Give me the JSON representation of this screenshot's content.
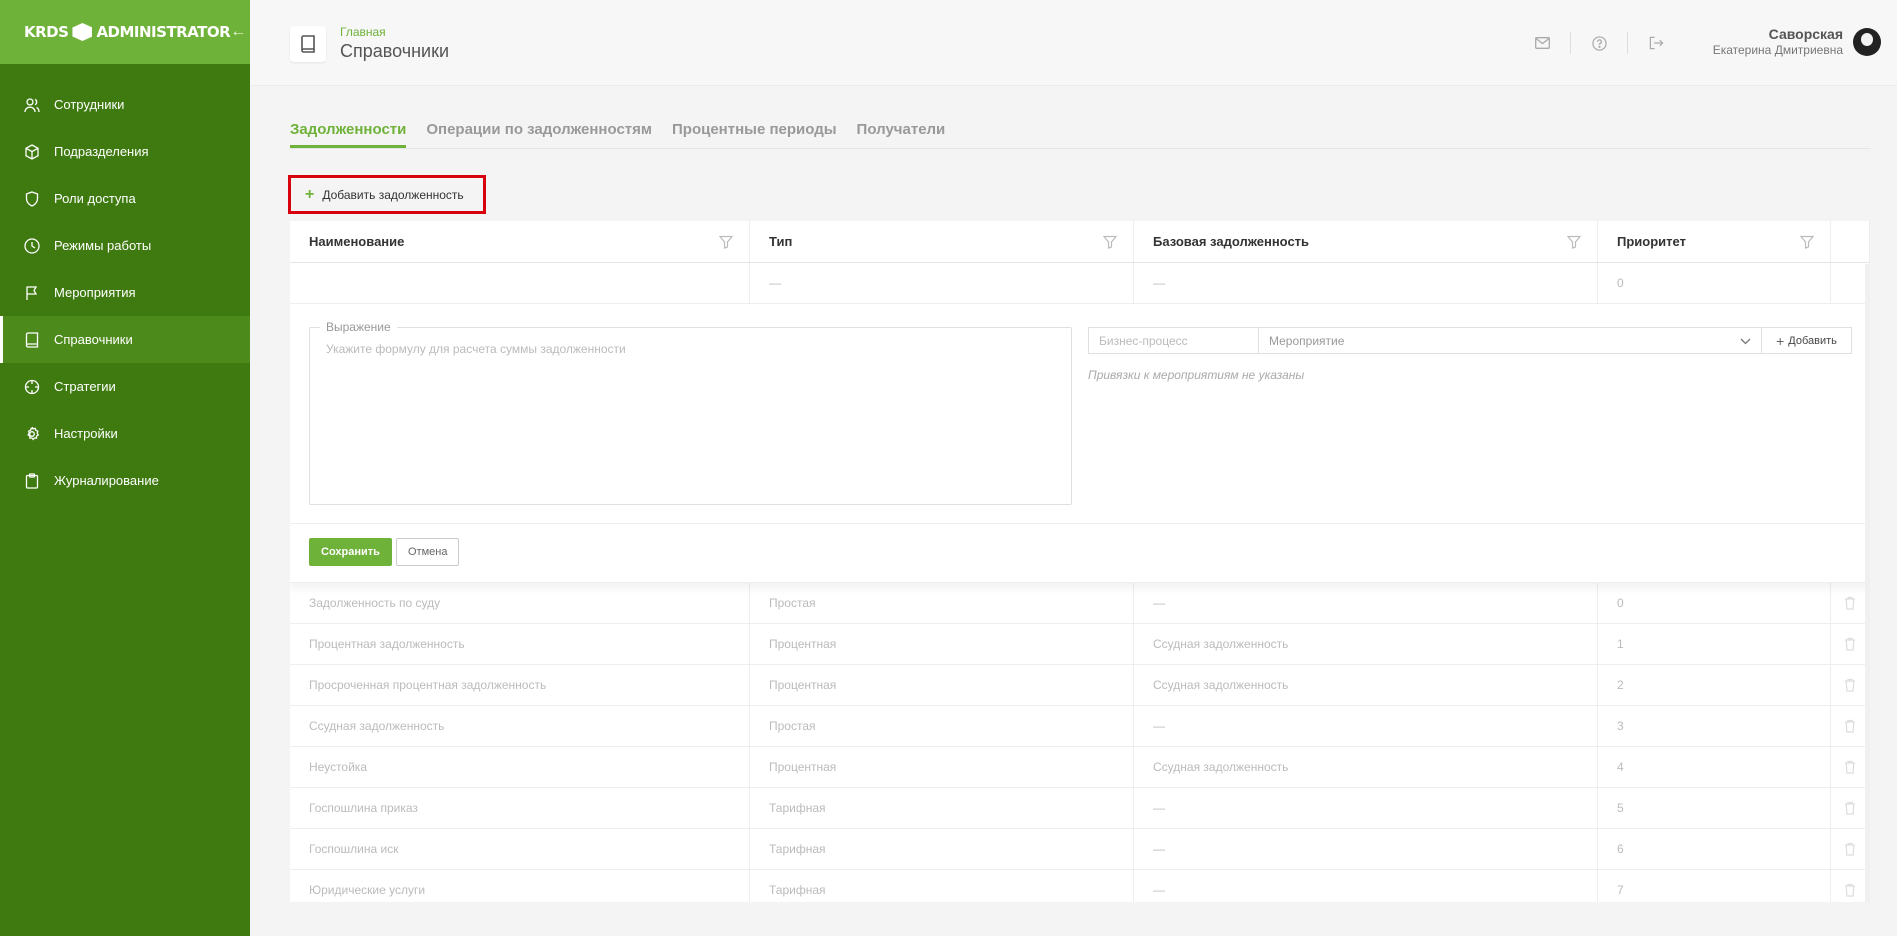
{
  "brand": {
    "left": "KRDS",
    "right": "ADMINISTRATOR"
  },
  "sidebar": {
    "items": [
      {
        "label": "Сотрудники",
        "icon": "users-icon"
      },
      {
        "label": "Подразделения",
        "icon": "cube-icon"
      },
      {
        "label": "Роли доступа",
        "icon": "shield-icon"
      },
      {
        "label": "Режимы работы",
        "icon": "clock-icon"
      },
      {
        "label": "Мероприятия",
        "icon": "flag-icon"
      },
      {
        "label": "Справочники",
        "icon": "book-icon",
        "active": true
      },
      {
        "label": "Стратегии",
        "icon": "crosshair-icon"
      },
      {
        "label": "Настройки",
        "icon": "gear-icon"
      },
      {
        "label": "Журналирование",
        "icon": "clipboard-icon"
      }
    ]
  },
  "header": {
    "breadcrumb": "Главная",
    "title": "Справочники",
    "user_last_name": "Саворская",
    "user_first_names": "Екатерина Дмитриевна"
  },
  "tabs": [
    {
      "label": "Задолженности",
      "active": true
    },
    {
      "label": "Операции по задолженностям"
    },
    {
      "label": "Процентные периоды"
    },
    {
      "label": "Получатели"
    }
  ],
  "add_button": "Добавить задолженность",
  "table": {
    "columns": [
      "Наименование",
      "Тип",
      "Базовая задолженность",
      "Приоритет"
    ],
    "new_row": {
      "name": "",
      "type": "—",
      "base": "—",
      "priority": "0"
    },
    "edit": {
      "expr_label": "Выражение",
      "expr_placeholder": "Укажите формулу для расчета суммы задолженности",
      "process_placeholder": "Бизнес-процесс",
      "event_placeholder": "Мероприятие",
      "bind_add": "Добавить",
      "bind_empty": "Привязки к мероприятиям не указаны",
      "save": "Сохранить",
      "cancel": "Отмена"
    },
    "rows": [
      {
        "name": "Задолженность по суду",
        "type": "Простая",
        "base": "—",
        "priority": "0"
      },
      {
        "name": "Процентная задолженность",
        "type": "Процентная",
        "base": "Ссудная задолженность",
        "priority": "1"
      },
      {
        "name": "Просроченная процентная задолженность",
        "type": "Процентная",
        "base": "Ссудная задолженность",
        "priority": "2"
      },
      {
        "name": "Ссудная задолженность",
        "type": "Простая",
        "base": "—",
        "priority": "3"
      },
      {
        "name": "Неустойка",
        "type": "Процентная",
        "base": "Ссудная задолженность",
        "priority": "4"
      },
      {
        "name": "Госпошлина приказ",
        "type": "Тарифная",
        "base": "—",
        "priority": "5"
      },
      {
        "name": "Госпошлина иск",
        "type": "Тарифная",
        "base": "—",
        "priority": "6"
      },
      {
        "name": "Юридические услуги",
        "type": "Тарифная",
        "base": "—",
        "priority": "7"
      }
    ]
  },
  "colors": {
    "sidebar": "#3f7a10",
    "brand": "#6fb23a",
    "accent": "#6fb23a",
    "highlight": "#d8000c"
  }
}
